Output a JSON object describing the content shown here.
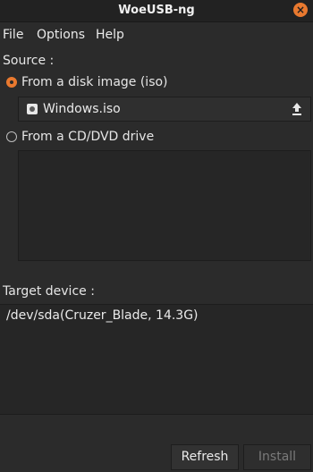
{
  "window": {
    "title": "WoeUSB-ng",
    "close_glyph": "×"
  },
  "menu": [
    "File",
    "Options",
    "Help"
  ],
  "source": {
    "label": "Source :",
    "options": [
      {
        "label": "From a disk image (iso)",
        "selected": true
      },
      {
        "label": "From a CD/DVD drive",
        "selected": false
      }
    ],
    "iso_file": {
      "name": "Windows.iso",
      "icon": "disc-icon",
      "browse_icon": "upload-icon"
    }
  },
  "target": {
    "label": "Target device :",
    "devices": [
      "/dev/sda(Cruzer_Blade, 14.3G)"
    ]
  },
  "buttons": {
    "refresh": "Refresh",
    "install": "Install"
  },
  "colors": {
    "accent": "#e9792f",
    "background": "#2b2b2b"
  }
}
